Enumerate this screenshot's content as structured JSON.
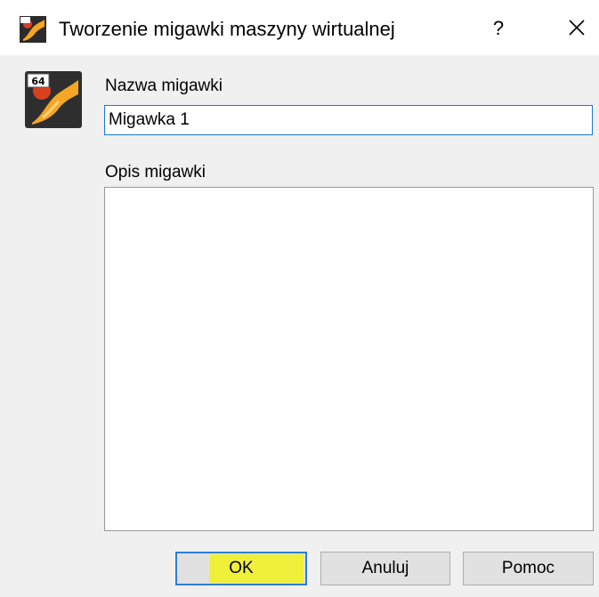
{
  "window": {
    "title": "Tworzenie migawki maszyny wirtualnej",
    "help_glyph": "?",
    "title_icon": "virtualbox-icon",
    "close_icon": "close-icon"
  },
  "form": {
    "name_label": "Nazwa migawki",
    "name_value": "Migawka 1",
    "description_label": "Opis migawki",
    "description_value": "",
    "app_icon": "virtualbox-64bit-icon",
    "app_icon_badge": "64"
  },
  "buttons": {
    "ok": "OK",
    "cancel": "Anuluj",
    "help": "Pomoc"
  },
  "colors": {
    "focus_border": "#1d79d6",
    "highlight": "#f2f21c",
    "background": "#f0f0f0"
  }
}
